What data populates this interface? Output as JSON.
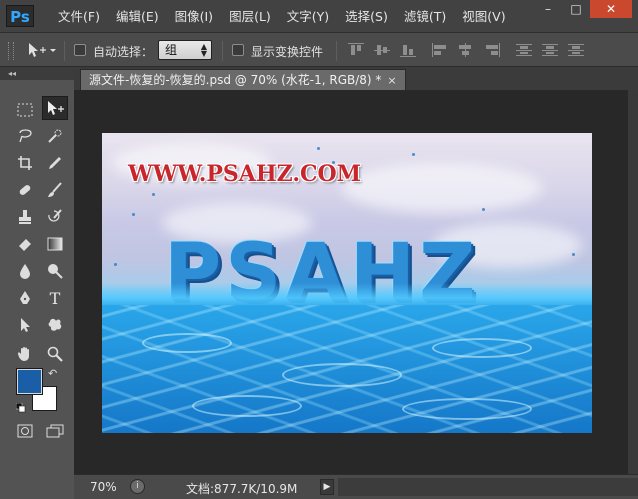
{
  "app": {
    "logo": "Ps"
  },
  "menu": [
    "文件(F)",
    "编辑(E)",
    "图像(I)",
    "图层(L)",
    "文字(Y)",
    "选择(S)",
    "滤镜(T)",
    "视图(V)"
  ],
  "window_controls": {
    "minimize": "–",
    "maximize": "□",
    "close": "✕"
  },
  "options_bar": {
    "auto_select_label": "自动选择：",
    "auto_select_checked": false,
    "auto_select_value": "组",
    "show_transform_label": "显示变换控件",
    "show_transform_checked": false
  },
  "toolbox": {
    "collapse_glyph": "◂◂",
    "foreground_color": "#1b5ea8",
    "background_color": "#ffffff"
  },
  "document": {
    "tab_title": "源文件-恢复的-恢复的.psd @ 70% (水花-1, RGB/8) *",
    "tab_close": "×",
    "watermark_text": "WWW.PSAHZ.COM",
    "artwork_text": "PSAHZ"
  },
  "status": {
    "zoom": "70%",
    "doc_info": "文档:877.7K/10.9M",
    "arrow": "▶"
  }
}
